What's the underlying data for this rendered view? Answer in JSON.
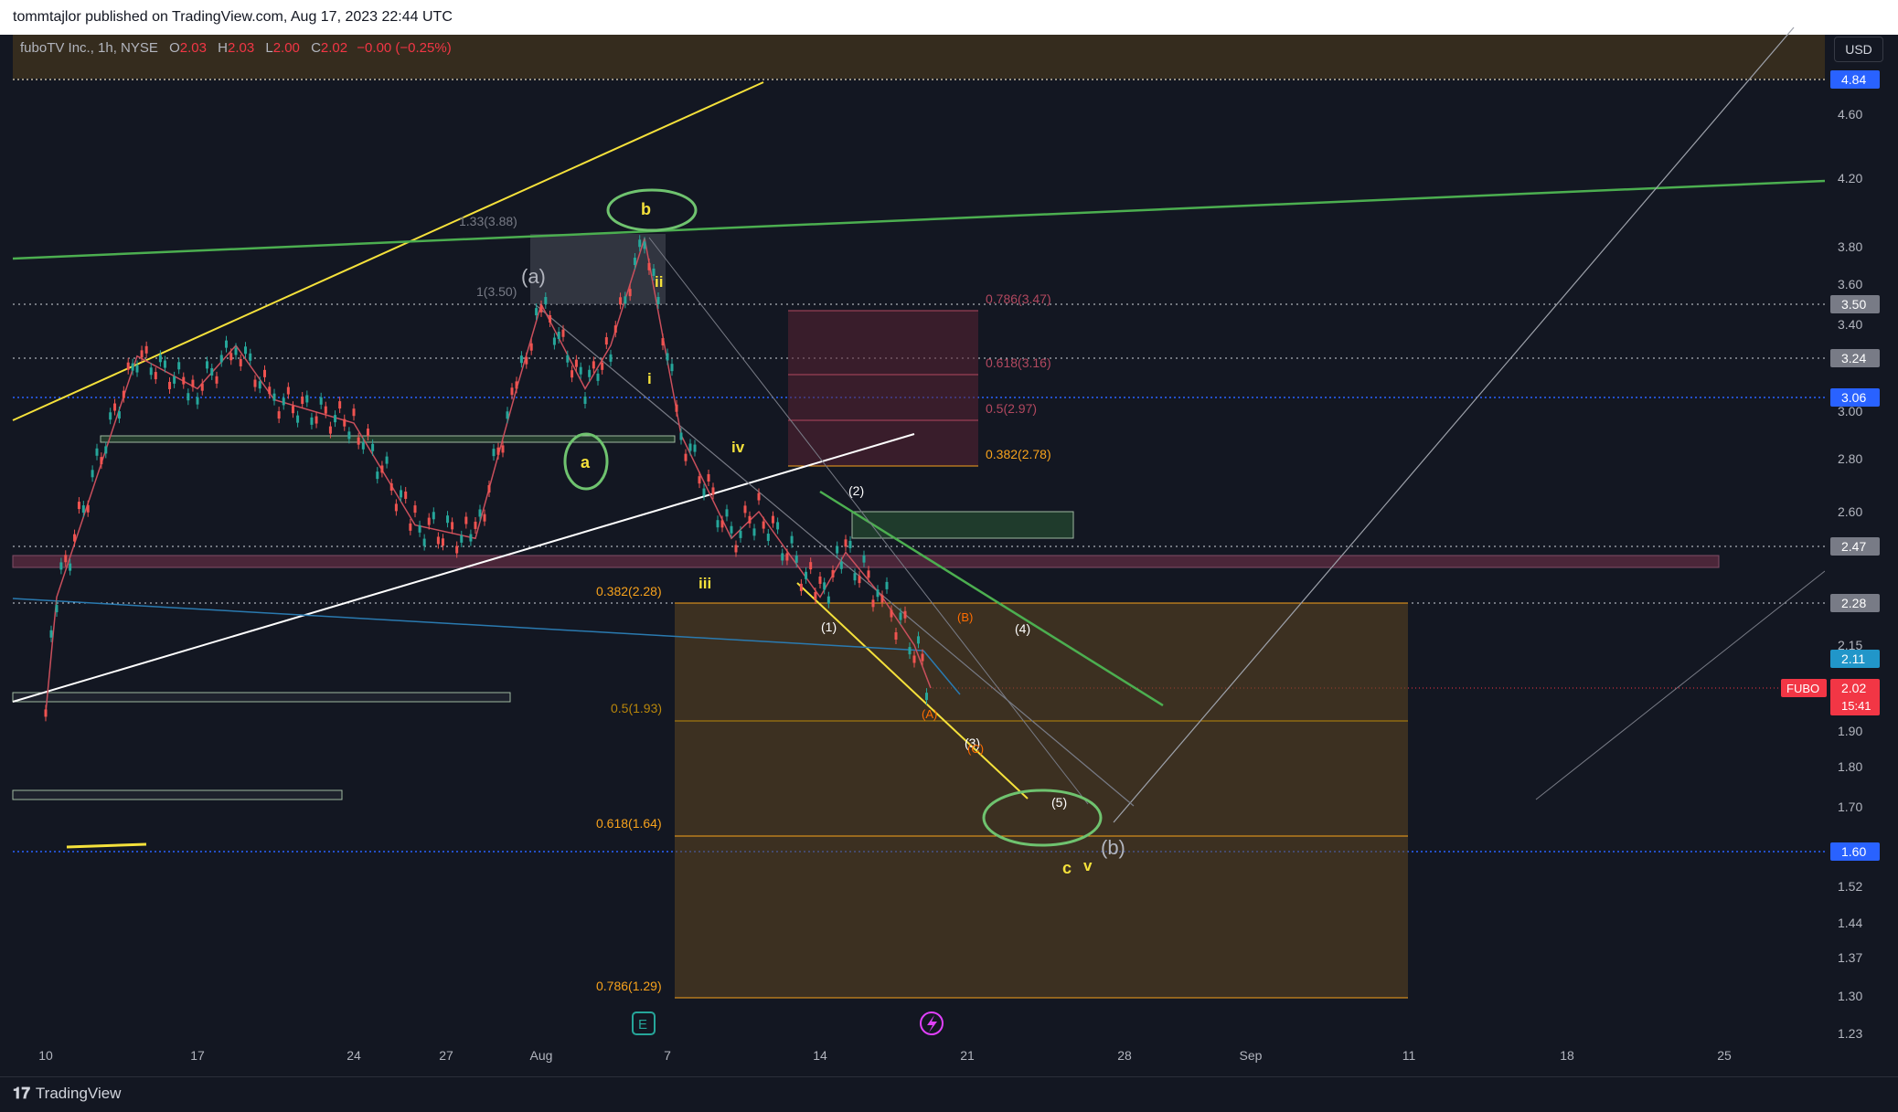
{
  "header": {
    "publisher_line": "tommtajlor published on TradingView.com, Aug 17, 2023 22:44 UTC"
  },
  "footer": {
    "brand": "TradingView"
  },
  "legend": {
    "symbol": "fuboTV Inc., 1h, NYSE",
    "open_label": "O",
    "open": "2.03",
    "high_label": "H",
    "high": "2.03",
    "low_label": "L",
    "low": "2.00",
    "close_label": "C",
    "close": "2.02",
    "change": "−0.00 (−0.25%)"
  },
  "currency": "USD",
  "price_axis": {
    "ticks": [
      "4.60",
      "4.20",
      "3.80",
      "3.60",
      "3.40",
      "3.00",
      "2.80",
      "2.60",
      "2.15",
      "1.90",
      "1.80",
      "1.70",
      "1.52",
      "1.44",
      "1.37",
      "1.30",
      "1.23"
    ],
    "badges": [
      {
        "label": "4.84",
        "color": "#2962ff"
      },
      {
        "label": "3.50",
        "color": "#787b86"
      },
      {
        "label": "3.24",
        "color": "#787b86"
      },
      {
        "label": "3.06",
        "color": "#2962ff"
      },
      {
        "label": "2.47",
        "color": "#787b86"
      },
      {
        "label": "2.28",
        "color": "#787b86"
      },
      {
        "label": "2.11",
        "color": "#2196c9"
      },
      {
        "label": "2.02",
        "color": "#f23645"
      },
      {
        "label": "1.60",
        "color": "#2962ff"
      }
    ],
    "symbol_tag": "FUBO",
    "countdown": "15:41"
  },
  "time_axis": {
    "ticks": [
      "10",
      "17",
      "24",
      "27",
      "Aug",
      "7",
      "14",
      "21",
      "28",
      "Sep",
      "11",
      "18",
      "25"
    ]
  },
  "fib_labels": {
    "upper": [
      {
        "text": "0.786(3.47)",
        "color": "#b2485f"
      },
      {
        "text": "0.618(3.16)",
        "color": "#b2485f"
      },
      {
        "text": "0.5(2.97)",
        "color": "#b2485f"
      },
      {
        "text": "0.382(2.78)",
        "color": "#f7a21c"
      }
    ],
    "lower": [
      {
        "text": "0.382(2.28)",
        "color": "#f7a21c"
      },
      {
        "text": "0.5(1.93)",
        "color": "#b8860b"
      },
      {
        "text": "0.618(1.64)",
        "color": "#f7a21c"
      },
      {
        "text": "0.786(1.29)",
        "color": "#f7a21c"
      }
    ],
    "extension": [
      {
        "text": "1.33(3.88)",
        "color": "#787b86"
      },
      {
        "text": "1(3.50)",
        "color": "#787b86"
      }
    ]
  },
  "wave_labels": {
    "a_paren": "(a)",
    "b_paren": "(b)",
    "b": "b",
    "a": "a",
    "c": "c",
    "i": "i",
    "ii": "ii",
    "iii": "iii",
    "iv": "iv",
    "v": "v",
    "w1": "(1)",
    "w2": "(2)",
    "w3": "(3)",
    "w4": "(4)",
    "w5": "(5)",
    "A": "(A)",
    "B": "(B)",
    "C": "(C)"
  },
  "event_markers": {
    "earnings": "E"
  },
  "chart_data": {
    "type": "line",
    "title": "fuboTV Inc., 1h, NYSE",
    "series": [
      {
        "name": "FUBO",
        "x": [
          "Jul 10",
          "Jul 11",
          "Jul 14",
          "Jul 17",
          "Jul 19",
          "Jul 21",
          "Jul 24",
          "Jul 26",
          "Jul 28",
          "Jul 31",
          "Aug 1",
          "Aug 3",
          "Aug 4",
          "Aug 7",
          "Aug 8",
          "Aug 10",
          "Aug 11",
          "Aug 14",
          "Aug 15",
          "Aug 16",
          "Aug 17",
          "Aug 18"
        ],
        "values": [
          1.95,
          2.3,
          3.25,
          3.1,
          3.3,
          3.05,
          2.95,
          2.55,
          2.5,
          3.1,
          3.5,
          3.1,
          3.3,
          3.85,
          2.9,
          2.5,
          2.6,
          2.3,
          2.45,
          2.3,
          2.15,
          2.02
        ]
      }
    ],
    "ylim": [
      1.23,
      4.84
    ],
    "xlim": [
      "Jul 10",
      "Sep 25"
    ]
  }
}
